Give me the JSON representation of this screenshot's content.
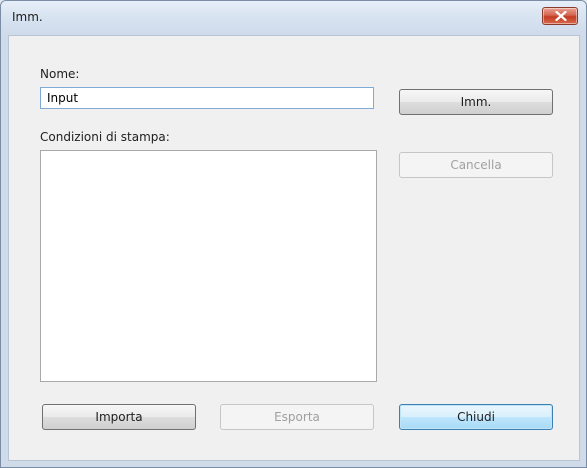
{
  "window": {
    "title": "Imm."
  },
  "form": {
    "name_label": "Nome:",
    "name_value": "Input",
    "conditions_label": "Condizioni di stampa:",
    "conditions_items": []
  },
  "buttons": {
    "register": "Imm.",
    "delete": "Cancella",
    "import": "Importa",
    "export": "Esporta",
    "close": "Chiudi"
  },
  "colors": {
    "close_button": "#c9442a",
    "default_button_border": "#3c7fb1"
  }
}
